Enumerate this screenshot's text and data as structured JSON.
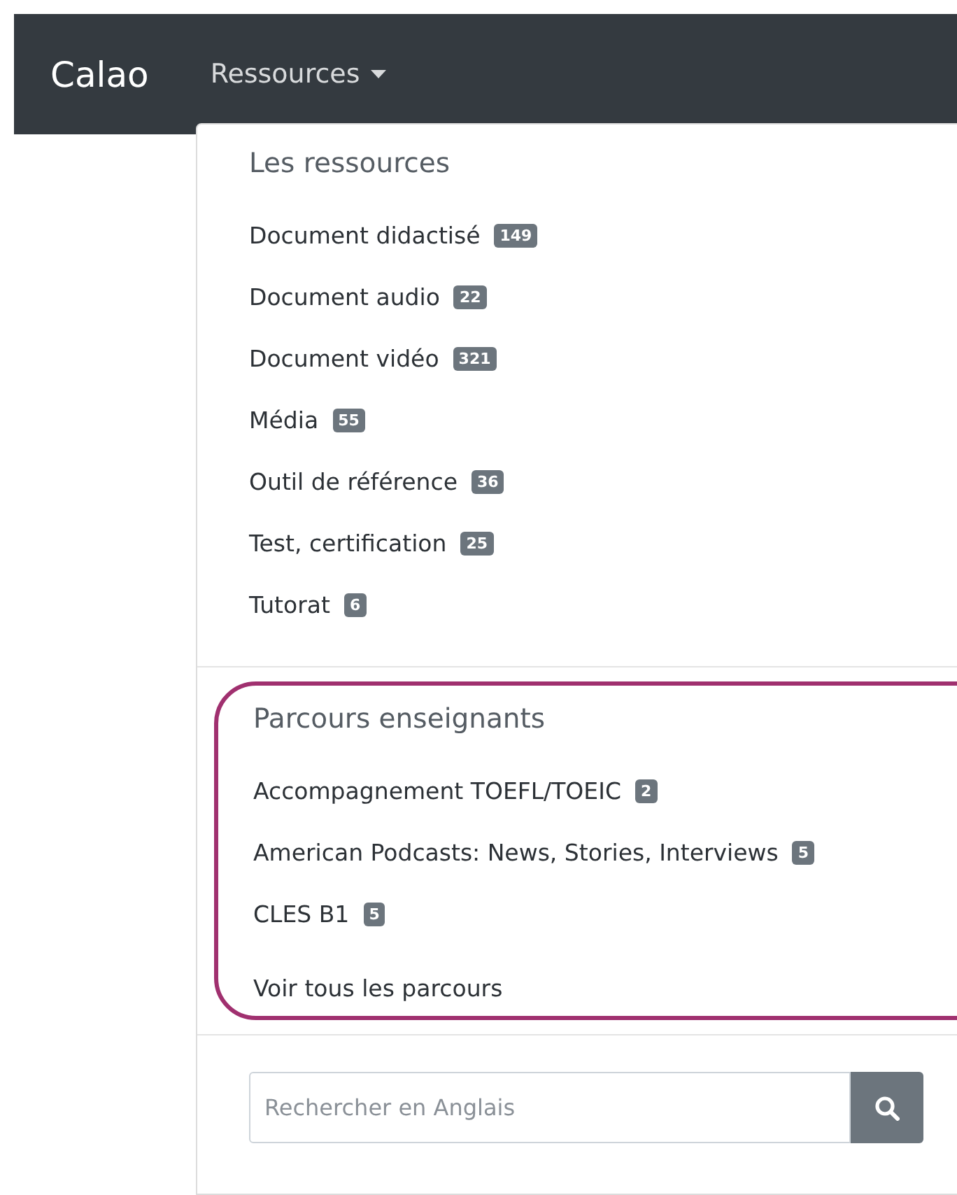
{
  "navbar": {
    "brand": "Calao",
    "menu": {
      "label": "Ressources",
      "expanded": true
    }
  },
  "dropdown": {
    "sections": [
      {
        "title": "Les ressources",
        "highlighted": false,
        "items": [
          {
            "label": "Document didactisé",
            "count": "149"
          },
          {
            "label": "Document audio",
            "count": "22"
          },
          {
            "label": "Document vidéo",
            "count": "321"
          },
          {
            "label": "Média",
            "count": "55"
          },
          {
            "label": "Outil de référence",
            "count": "36"
          },
          {
            "label": "Test, certification",
            "count": "25"
          },
          {
            "label": "Tutorat",
            "count": "6"
          }
        ]
      },
      {
        "title": "Parcours enseignants",
        "highlighted": true,
        "items": [
          {
            "label": "Accompagnement TOEFL/TOEIC",
            "count": "2"
          },
          {
            "label": "American Podcasts: News, Stories, Interviews",
            "count": "5"
          },
          {
            "label": "CLES B1",
            "count": "5"
          }
        ],
        "link": "Voir tous les parcours"
      }
    ],
    "search": {
      "placeholder": "Rechercher en Anglais"
    }
  }
}
